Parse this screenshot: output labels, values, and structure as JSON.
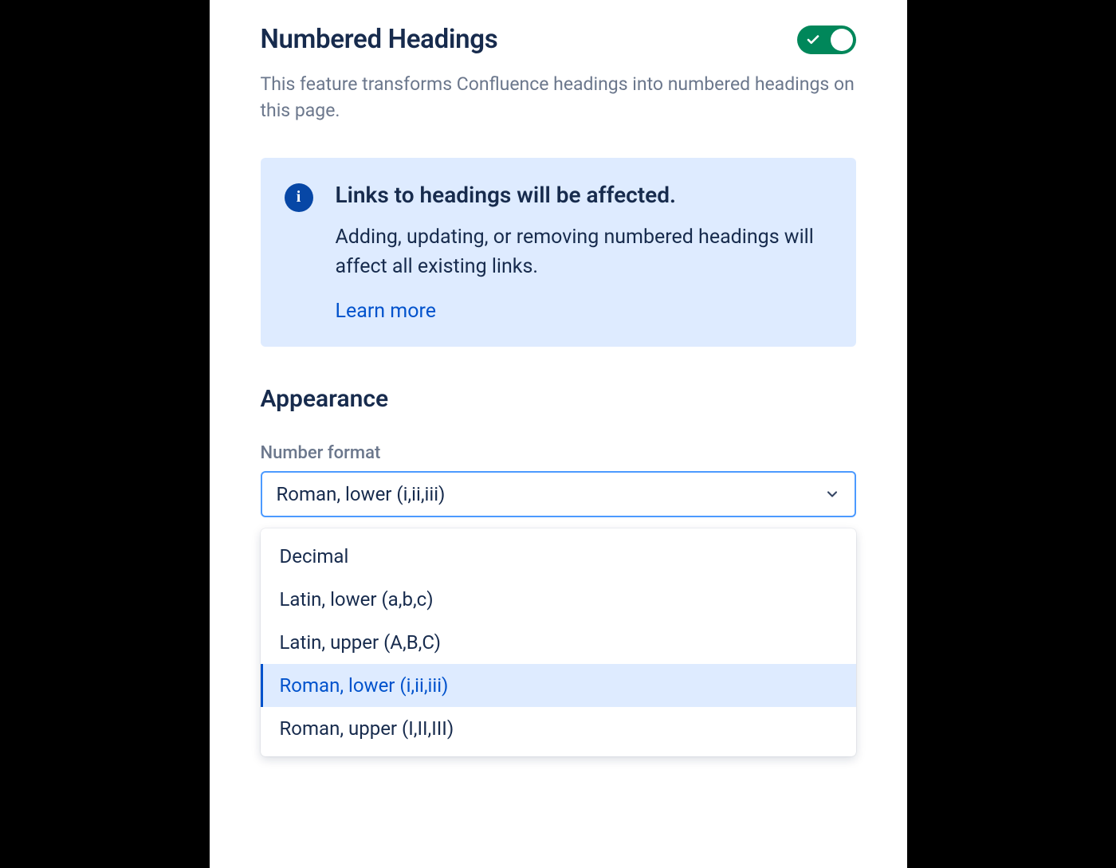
{
  "feature": {
    "title": "Numbered Headings",
    "description": "This feature transforms Confluence headings into numbered headings on this page.",
    "enabled": true
  },
  "info_banner": {
    "title": "Links to headings will be affected.",
    "description": "Adding, updating, or removing numbered headings will affect all existing links.",
    "link_label": "Learn more"
  },
  "appearance": {
    "section_title": "Appearance",
    "number_format": {
      "label": "Number format",
      "selected": "Roman, lower (i,ii,iii)",
      "options": [
        "Decimal",
        "Latin, lower (a,b,c)",
        "Latin, upper (A,B,C)",
        "Roman, lower (i,ii,iii)",
        "Roman, upper (I,II,III)"
      ],
      "selected_index": 3
    }
  }
}
